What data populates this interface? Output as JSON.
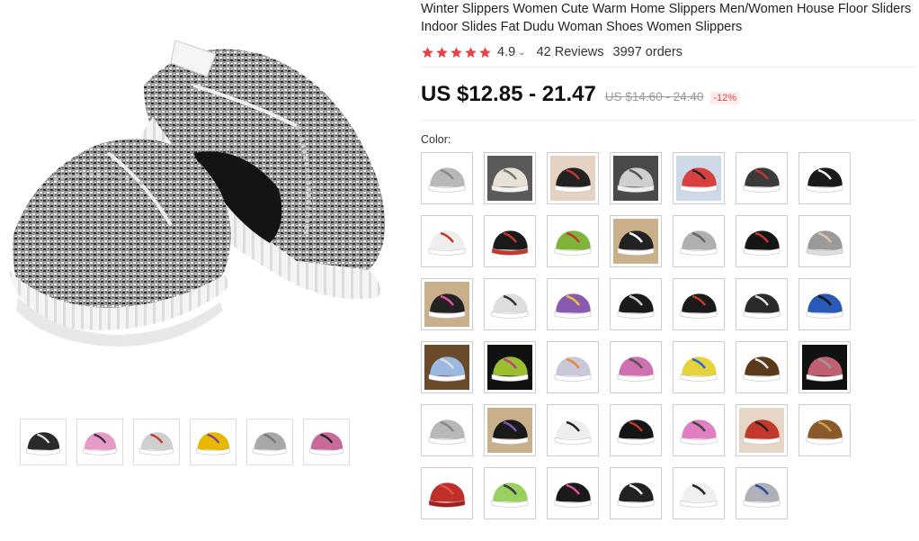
{
  "product": {
    "title": "Winter Slippers Women Cute Warm Home Slippers Men/Women House Floor Sliders Indoor Slides Fat Dudu Woman Shoes Women Slippers",
    "rating": "4.9",
    "reviews": "42 Reviews",
    "orders": "3997 orders",
    "price": "US $12.85 - 21.47",
    "original_price": "US $14.60 - 24.40",
    "discount": "-12%"
  },
  "colors": {
    "star": "#e64545",
    "discount_text": "#e64545",
    "discount_bg": "#fdecec"
  },
  "options": {
    "color_label": "Color:"
  },
  "thumbnails": [
    {
      "icon": "slipper-black-white-icon",
      "body": "#2a2a2a",
      "sole": "#ffffff",
      "accent": "#dddddd"
    },
    {
      "icon": "slipper-pink-icon",
      "body": "#e59ac8",
      "sole": "#ffffff",
      "accent": "#333333"
    },
    {
      "icon": "slipper-zebra-icon",
      "body": "#cfcfcf",
      "sole": "#ffffff",
      "accent": "#c0392b"
    },
    {
      "icon": "slipper-yellow-purple-icon",
      "body": "#e6b800",
      "sole": "#ffffff",
      "accent": "#7a3fa0"
    },
    {
      "icon": "slipper-grey-icon",
      "body": "#a8a8a8",
      "sole": "#ffffff",
      "accent": "#777777"
    },
    {
      "icon": "slipper-pink-black-icon",
      "body": "#c76a9a",
      "sole": "#ffffff",
      "accent": "#222222"
    }
  ],
  "swatches": [
    {
      "icon": "slipper-grey-icon",
      "body": "#b8b8b8",
      "sole": "#ffffff",
      "accent": "#8a8a8a",
      "bg": "#ffffff"
    },
    {
      "icon": "slipper-white-icon",
      "body": "#e8e2d6",
      "sole": "#f5f5f5",
      "accent": "#777777",
      "bg": "#5a5a5a"
    },
    {
      "icon": "slipper-black-red-icon",
      "body": "#222222",
      "sole": "#ffffff",
      "accent": "#c0392b",
      "bg": "#e6d2c2"
    },
    {
      "icon": "slipper-grey-icon",
      "body": "#cfcfcf",
      "sole": "#f0f0f0",
      "accent": "#555555",
      "bg": "#4a4a4a"
    },
    {
      "icon": "slipper-red-black-icon",
      "body": "#d84040",
      "sole": "#ffffff",
      "accent": "#222222",
      "bg": "#cfdae8"
    },
    {
      "icon": "slipper-black-red-icon",
      "body": "#3a3a3a",
      "sole": "#ffffff",
      "accent": "#c0392b",
      "bg": "#ffffff"
    },
    {
      "icon": "slipper-black-icon",
      "body": "#1a1a1a",
      "sole": "#ffffff",
      "accent": "#f0f0f0",
      "bg": "#ffffff"
    },
    {
      "icon": "slipper-white-red-icon",
      "body": "#eeeeee",
      "sole": "#ffffff",
      "accent": "#c0392b",
      "bg": "#ffffff"
    },
    {
      "icon": "slipper-black-red-icon",
      "body": "#1a1a1a",
      "sole": "#c0392b",
      "accent": "#c0392b",
      "bg": "#ffffff"
    },
    {
      "icon": "slipper-green-icon",
      "body": "#7fb33a",
      "sole": "#ffffff",
      "accent": "#c0392b",
      "bg": "#ffffff"
    },
    {
      "icon": "slipper-black-white-icon",
      "body": "#222222",
      "sole": "#ffffff",
      "accent": "#ffffff",
      "bg": "#c9b08a"
    },
    {
      "icon": "slipper-grey-icon",
      "body": "#b0b0b0",
      "sole": "#ffffff",
      "accent": "#666666",
      "bg": "#ffffff"
    },
    {
      "icon": "slipper-black-red-icon",
      "body": "#151515",
      "sole": "#ffffff",
      "accent": "#c0392b",
      "bg": "#ffffff"
    },
    {
      "icon": "slipper-plush-grey-icon",
      "body": "#9a9a9a",
      "sole": "#dddddd",
      "accent": "#d8c8a8",
      "bg": "#ffffff"
    },
    {
      "icon": "slipper-black-pink-icon",
      "body": "#222222",
      "sole": "#ffffff",
      "accent": "#e64fa0",
      "bg": "#c9b08a"
    },
    {
      "icon": "slipper-zebra-icon",
      "body": "#dddddd",
      "sole": "#ffffff",
      "accent": "#333333",
      "bg": "#ffffff"
    },
    {
      "icon": "slipper-rainbow-icon",
      "body": "#8a5ab0",
      "sole": "#ffffff",
      "accent": "#e6c53a",
      "bg": "#ffffff"
    },
    {
      "icon": "slipper-black-white-icon",
      "body": "#1a1a1a",
      "sole": "#ffffff",
      "accent": "#cccccc",
      "bg": "#ffffff"
    },
    {
      "icon": "slipper-black-red-icon",
      "body": "#1a1a1a",
      "sole": "#ffffff",
      "accent": "#c0392b",
      "bg": "#ffffff"
    },
    {
      "icon": "slipper-black-white-icon",
      "body": "#2a2a2a",
      "sole": "#ffffff",
      "accent": "#dddddd",
      "bg": "#ffffff"
    },
    {
      "icon": "slipper-blue-black-icon",
      "body": "#2a5ab8",
      "sole": "#ffffff",
      "accent": "#111111",
      "bg": "#ffffff"
    },
    {
      "icon": "slipper-blue-white-icon",
      "body": "#9ab8e0",
      "sole": "#ffffff",
      "accent": "#e0e0e0",
      "bg": "#6a4a2a"
    },
    {
      "icon": "slipper-green-icon",
      "body": "#9ac030",
      "sole": "#ffffff",
      "accent": "#c04080",
      "bg": "#111111"
    },
    {
      "icon": "slipper-rainbow-icon",
      "body": "#c8c8d8",
      "sole": "#ffffff",
      "accent": "#e68a3a",
      "bg": "#ffffff"
    },
    {
      "icon": "slipper-pink-icon",
      "body": "#d070b0",
      "sole": "#ffffff",
      "accent": "#555555",
      "bg": "#ffffff"
    },
    {
      "icon": "slipper-yellow-blue-icon",
      "body": "#e6d23a",
      "sole": "#ffffff",
      "accent": "#2a6ad0",
      "bg": "#ffffff"
    },
    {
      "icon": "slipper-brown-icon",
      "body": "#5a3a1a",
      "sole": "#ffffff",
      "accent": "#e6e6e6",
      "bg": "#ffffff"
    },
    {
      "icon": "slipper-pink-grey-icon",
      "body": "#c06070",
      "sole": "#ffffff",
      "accent": "#999999",
      "bg": "#111111"
    },
    {
      "icon": "slipper-silver-icon",
      "body": "#b8b8b8",
      "sole": "#ffffff",
      "accent": "#888888",
      "bg": "#ffffff"
    },
    {
      "icon": "slipper-black-purple-icon",
      "body": "#1a1a1a",
      "sole": "#ffffff",
      "accent": "#7a5ab0",
      "bg": "#c9b08a"
    },
    {
      "icon": "slipper-white-black-icon",
      "body": "#eeeeee",
      "sole": "#ffffff",
      "accent": "#222222",
      "bg": "#ffffff"
    },
    {
      "icon": "slipper-black-red-icon",
      "body": "#151515",
      "sole": "#ffffff",
      "accent": "#c0392b",
      "bg": "#ffffff"
    },
    {
      "icon": "slipper-pink-icon",
      "body": "#e080c0",
      "sole": "#ffffff",
      "accent": "#444444",
      "bg": "#ffffff"
    },
    {
      "icon": "slipper-red-icon",
      "body": "#c0392b",
      "sole": "#ffffff",
      "accent": "#222222",
      "bg": "#e6d6c6"
    },
    {
      "icon": "slipper-brown-icon",
      "body": "#8a5a2a",
      "sole": "#ffffff",
      "accent": "#c8a050",
      "bg": "#ffffff"
    },
    {
      "icon": "slipper-red-icon",
      "body": "#c0302a",
      "sole": "#a02020",
      "accent": "#e05050",
      "bg": "#ffffff"
    },
    {
      "icon": "slipper-green-icon",
      "body": "#9ad060",
      "sole": "#ffffff",
      "accent": "#3a3a3a",
      "bg": "#ffffff"
    },
    {
      "icon": "slipper-black-pink-icon",
      "body": "#1a1a1a",
      "sole": "#ffffff",
      "accent": "#e64fa0",
      "bg": "#ffffff"
    },
    {
      "icon": "slipper-black-white-icon",
      "body": "#222222",
      "sole": "#ffffff",
      "accent": "#eeeeee",
      "bg": "#ffffff"
    },
    {
      "icon": "slipper-white-black-icon",
      "body": "#f0f0f0",
      "sole": "#ffffff",
      "accent": "#222222",
      "bg": "#ffffff"
    },
    {
      "icon": "slipper-grey-blue-icon",
      "body": "#b0b0b8",
      "sole": "#ffffff",
      "accent": "#2a4aa0",
      "bg": "#ffffff"
    }
  ]
}
